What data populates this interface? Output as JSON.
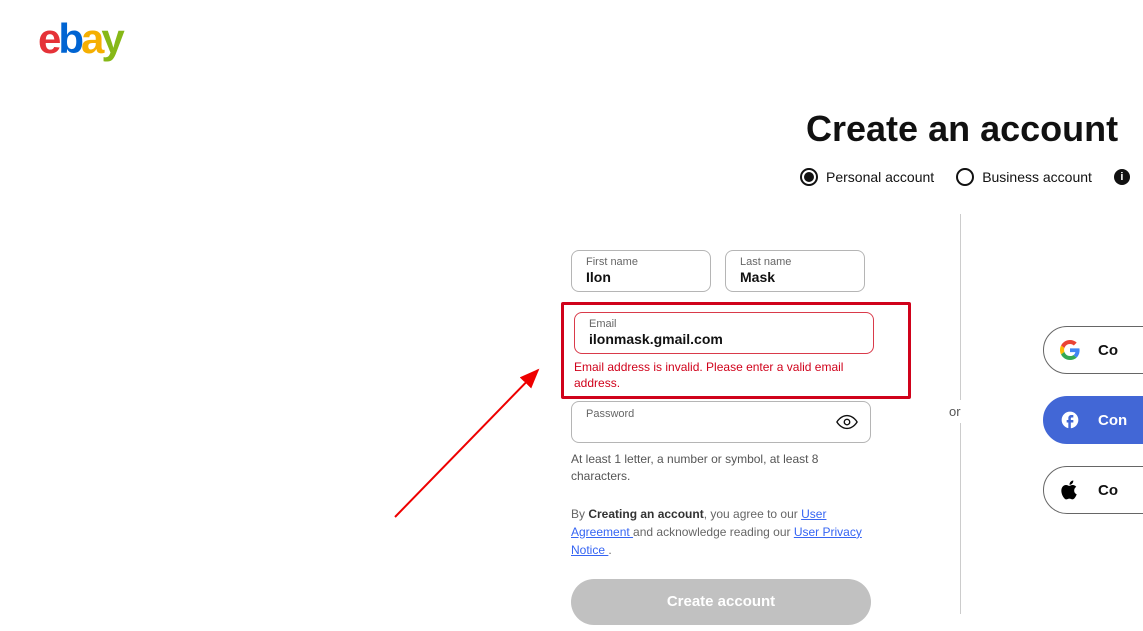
{
  "logo": {
    "e": "e",
    "b": "b",
    "a": "a",
    "y": "y"
  },
  "page_title": "Create an account",
  "account_types": {
    "personal": "Personal account",
    "business": "Business account"
  },
  "form": {
    "first_name": {
      "label": "First name",
      "value": "Ilon"
    },
    "last_name": {
      "label": "Last name",
      "value": "Mask"
    },
    "email": {
      "label": "Email",
      "value": "ilonmask.gmail.com",
      "error": "Email address is invalid. Please enter a valid email address."
    },
    "password": {
      "label": "Password",
      "value": "",
      "hint": "At least 1 letter, a number or symbol, at least 8 characters."
    }
  },
  "terms": {
    "prefix": "By ",
    "bold": "Creating an account",
    "mid1": ", you agree to our ",
    "link1": "User Agreement ",
    "mid2": "and acknowledge reading our ",
    "link2": "User Privacy Notice ",
    "suffix": "."
  },
  "create_button": "Create account",
  "or": "or",
  "social": {
    "google": "Co",
    "facebook": "Con",
    "apple": "Co"
  }
}
